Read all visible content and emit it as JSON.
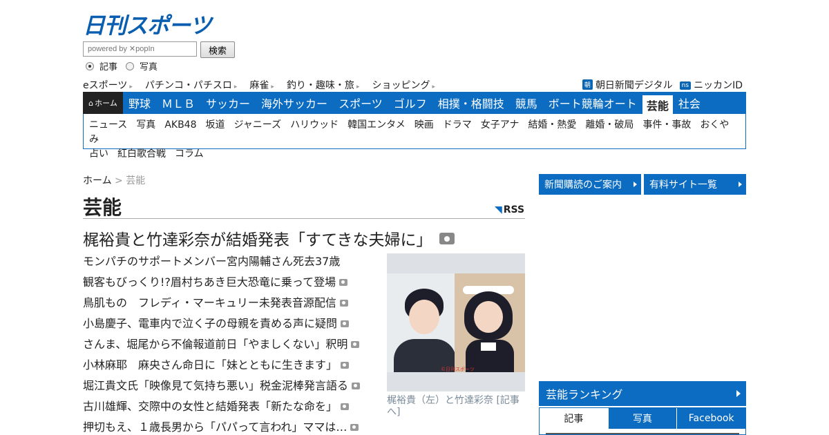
{
  "site": {
    "logo": "日刊スポーツ"
  },
  "search": {
    "placeholder": "powered by ✕popIn",
    "button": "検索",
    "radio_articles": "記事",
    "radio_photos": "写真"
  },
  "top_links": [
    "eスポーツ",
    "パチンコ・パチスロ",
    "麻雀",
    "釣り・趣味・旅",
    "ショッピング"
  ],
  "ext_links": [
    {
      "badge": "朝",
      "label": "朝日新聞デジタル"
    },
    {
      "badge": "ns",
      "label": "ニッカンID"
    }
  ],
  "nav": {
    "home": "ホーム",
    "items": [
      "野球",
      "ＭＬＢ",
      "サッカー",
      "海外サッカー",
      "スポーツ",
      "ゴルフ",
      "相撲・格闘技",
      "競馬",
      "ボート競輪オート",
      "芸能",
      "社会"
    ],
    "active": "芸能"
  },
  "subnav": [
    "ニュース",
    "写真",
    "AKB48",
    "坂道",
    "ジャニーズ",
    "ハリウッド",
    "韓国エンタメ",
    "映画",
    "ドラマ",
    "女子アナ",
    "結婚・熱愛",
    "離婚・破局",
    "事件・事故",
    "おくやみ",
    "占い",
    "紅白歌合戦",
    "コラム"
  ],
  "breadcrumb": {
    "home": "ホーム",
    "sep": ">",
    "current": "芸能"
  },
  "page": {
    "title": "芸能",
    "rss": "RSS"
  },
  "headline": "梶裕貴と竹達彩奈が結婚発表「すてきな夫婦に」",
  "news": [
    {
      "text": "モンパチのサポートメンバー宮内陽輔さん死去37歳",
      "photo": false
    },
    {
      "text": "観客もびっくり!?眉村ちあき巨大恐竜に乗って登場",
      "photo": true
    },
    {
      "text": "鳥肌もの　フレディ・マーキュリー未発表音源配信",
      "photo": true
    },
    {
      "text": "小島慶子、電車内で泣く子の母親を責める声に疑問",
      "photo": true
    },
    {
      "text": "さんま、堀尾から不倫報道前日「やましくない」釈明",
      "photo": true
    },
    {
      "text": "小林麻耶　麻央さん命日に「妹とともに生きます」",
      "photo": true
    },
    {
      "text": "堀江貴文氏「映像見て気持ち悪い」税金泥棒発言語る",
      "photo": true
    },
    {
      "text": "古川雄輝、交際中の女性と結婚発表「新たな命を」",
      "photo": true
    },
    {
      "text": "押切もえ、１歳長男から「パパって言われ」ママは…",
      "photo": true
    }
  ],
  "photo": {
    "caption": "梶裕貴（左）と竹達彩奈 [記事へ]",
    "credit": "©日刊スポーツ"
  },
  "sidebar": {
    "btn1": "新聞購読のご案内",
    "btn2": "有料サイト一覧",
    "ranking_title": "芸能ランキング",
    "tabs": [
      "記事",
      "写真",
      "Facebook"
    ]
  },
  "colors": {
    "brand": "#0b6cc2",
    "home_bg": "#222222"
  }
}
